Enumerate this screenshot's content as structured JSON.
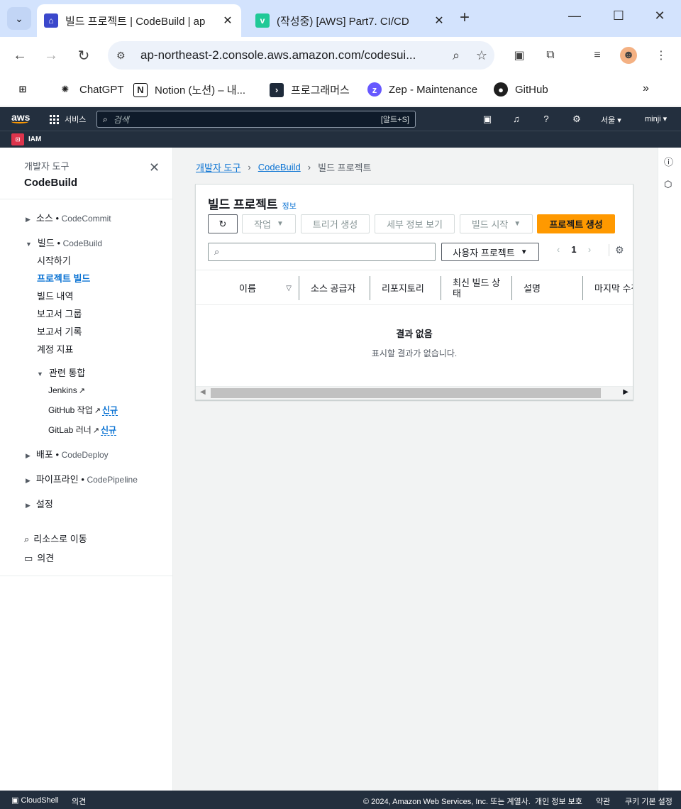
{
  "browser": {
    "tabs": [
      {
        "title": "빌드 프로젝트 | CodeBuild | ap",
        "favicon": "codebuild-favicon",
        "active": true
      },
      {
        "title": "(작성중) [AWS] Part7. CI/CD",
        "favicon": "velog-favicon",
        "active": false
      }
    ],
    "url": "ap-northeast-2.console.aws.amazon.com/codesui...",
    "bookmarks": [
      {
        "label": "ChatGPT",
        "icon": "chatgpt-icon"
      },
      {
        "label": "Notion (노션) – 내...",
        "icon": "notion-icon"
      },
      {
        "label": "프로그래머스",
        "icon": "programmers-icon"
      },
      {
        "label": "Zep - Maintenance",
        "icon": "zep-icon"
      },
      {
        "label": "GitHub",
        "icon": "github-icon"
      }
    ]
  },
  "aws": {
    "logo": "aws",
    "services_label": "서비스",
    "search_placeholder": "검색",
    "search_shortcut": "[알트+S]",
    "region": "서울",
    "user": "minji",
    "favorite": "IAM"
  },
  "sidenav": {
    "header_small": "개발자 도구",
    "header_big": "CodeBuild",
    "source": {
      "label": "소스",
      "service": "CodeCommit"
    },
    "build": {
      "label": "빌드",
      "service": "CodeBuild"
    },
    "build_items": [
      "시작하기",
      "프로젝트 빌드",
      "빌드 내역",
      "보고서 그룹",
      "보고서 기록",
      "계정 지표"
    ],
    "integrations_label": "관련 통합",
    "integrations": [
      {
        "label": "Jenkins",
        "badge": ""
      },
      {
        "label": "GitHub 작업",
        "badge": "신규"
      },
      {
        "label": "GitLab 러너",
        "badge": "신규"
      }
    ],
    "deploy": {
      "label": "배포",
      "service": "CodeDeploy"
    },
    "pipeline": {
      "label": "파이프라인",
      "service": "CodePipeline"
    },
    "settings": "설정",
    "go_to_resource": "리소스로 이동",
    "feedback": "의견"
  },
  "breadcrumb": {
    "root": "개발자 도구",
    "service": "CodeBuild",
    "current": "빌드 프로젝트"
  },
  "panel": {
    "title": "빌드 프로젝트",
    "info": "정보",
    "actions_label": "작업",
    "create_trigger": "트리거 생성",
    "view_details": "세부 정보 보기",
    "start_build": "빌드 시작",
    "create_project": "프로젝트 생성",
    "filter_placeholder": "",
    "project_scope": "사용자 프로젝트",
    "page": "1",
    "columns": [
      "이름",
      "소스 공급자",
      "리포지토리",
      "최신 빌드 상태",
      "설명",
      "마지막 수정"
    ],
    "empty_title": "결과 없음",
    "empty_sub": "표시할 결과가 없습니다."
  },
  "footer": {
    "cloudshell": "CloudShell",
    "feedback": "의견",
    "copyright": "© 2024, Amazon Web Services, Inc. 또는 계열사.",
    "privacy": "개인 정보 보호",
    "terms": "약관",
    "cookies": "쿠키 기본 설정"
  },
  "colors": {
    "accent": "#0972d3",
    "primary_button": "#ff9900",
    "aws_nav": "#232f3e",
    "chrome_tabstrip": "#d3e3fd"
  }
}
